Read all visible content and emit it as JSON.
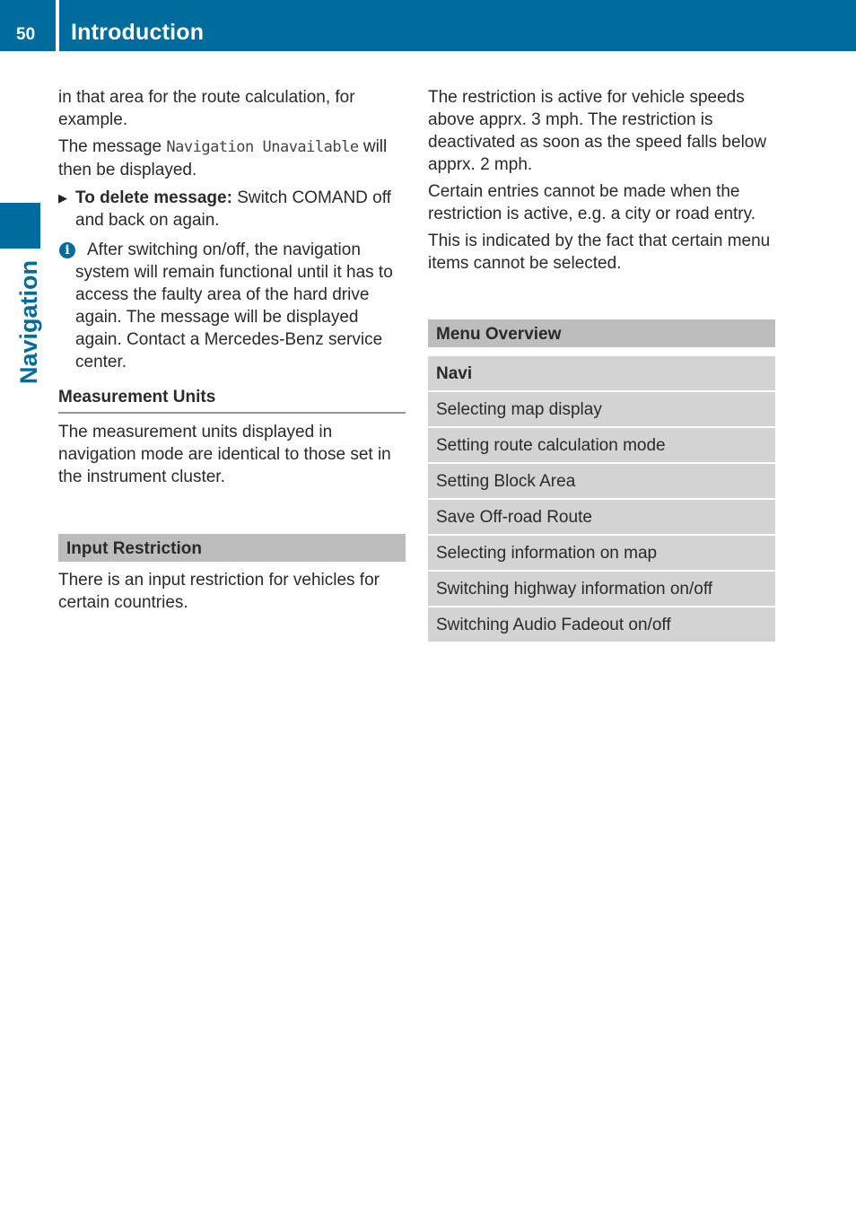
{
  "header": {
    "page_number": "50",
    "chapter_title": "Introduction",
    "accent_color": "#006c9e"
  },
  "side_tab": {
    "label": "Navigation"
  },
  "left_column": {
    "para1": "in that area for the route calculation, for example.",
    "para2_prefix": "The message ",
    "para2_code": "Navigation Unavailable",
    "para2_suffix": " will then be displayed.",
    "step": {
      "icon": "arrow-right-icon",
      "bold": "To delete message:",
      "text": " Switch COMAND off and back on again."
    },
    "note": {
      "icon": "info-icon",
      "text": "After switching on/off, the navigation system will remain functional until it has to access the faulty area of the hard drive again. The message will be displayed again. Contact a Mercedes-Benz service center."
    },
    "measurement_units": {
      "heading": "Measurement Units",
      "text": "The measurement units displayed in navigation mode are identical to those set in the instrument cluster."
    },
    "input_restriction": {
      "heading": "Input Restriction",
      "text": "There is an input restriction for vehicles for certain countries."
    }
  },
  "right_column": {
    "para1": "The restriction is active for vehicle speeds above apprx. 3 mph. The restriction is deactivated as soon as the speed falls below apprx. 2 mph.",
    "para2": "Certain entries cannot be made when the restriction is active, e.g. a city or road entry.",
    "para3": "This is indicated by the fact that certain menu items cannot be selected.",
    "menu_overview": {
      "heading": "Menu Overview",
      "table_header": "Navi",
      "rows": [
        "Selecting map display",
        "Setting route calculation mode",
        "Setting Block Area",
        "Save Off-road Route",
        "Selecting information on map",
        "Switching highway information on/off",
        "Switching Audio Fadeout on/off"
      ]
    }
  }
}
